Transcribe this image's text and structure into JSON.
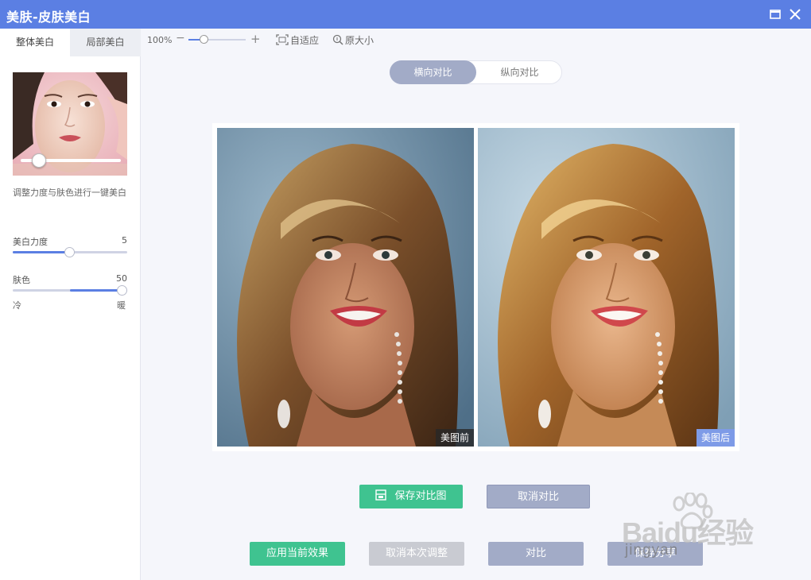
{
  "window": {
    "title": "美肤-皮肤美白"
  },
  "tabs": [
    {
      "label": "整体美白"
    },
    {
      "label": "局部美白"
    }
  ],
  "left_panel": {
    "description": "调整力度与肤色进行一键美白",
    "sliders": [
      {
        "label": "美白力度",
        "value": "5",
        "level_fraction": 0.5
      },
      {
        "label": "肤色",
        "value": "50",
        "level_fraction": 1.0
      }
    ],
    "temperature": {
      "cold": "冷",
      "warm": "暖"
    },
    "preview_slider_fraction": 0.1
  },
  "toolbar": {
    "zoom_percent": "100%",
    "zoom_minus": "−",
    "zoom_plus": "+",
    "fit_label": "自适应",
    "original_size_label": "原大小"
  },
  "compare_mode": {
    "options": [
      {
        "label": "横向对比",
        "selected": true
      },
      {
        "label": "纵向对比",
        "selected": false
      }
    ]
  },
  "compare": {
    "before_label": "美图前",
    "after_label": "美图后"
  },
  "buttons": {
    "save_compare": "保存对比图",
    "cancel_compare": "取消对比",
    "apply": "应用当前效果",
    "undo": "取消本次调整",
    "compare": "对比",
    "more": "保存分享"
  },
  "watermark": {
    "brand": "Baidu经验",
    "site": "jingyan"
  },
  "colors": {
    "accent": "#5b7fe3",
    "green": "#3fc390",
    "gray_blue": "#a2abc7"
  },
  "icons": [
    "restore-window-icon",
    "close-icon",
    "fit-screen-icon",
    "zoom-magnifier-icon",
    "save-icon",
    "baidu-paw-icon"
  ]
}
